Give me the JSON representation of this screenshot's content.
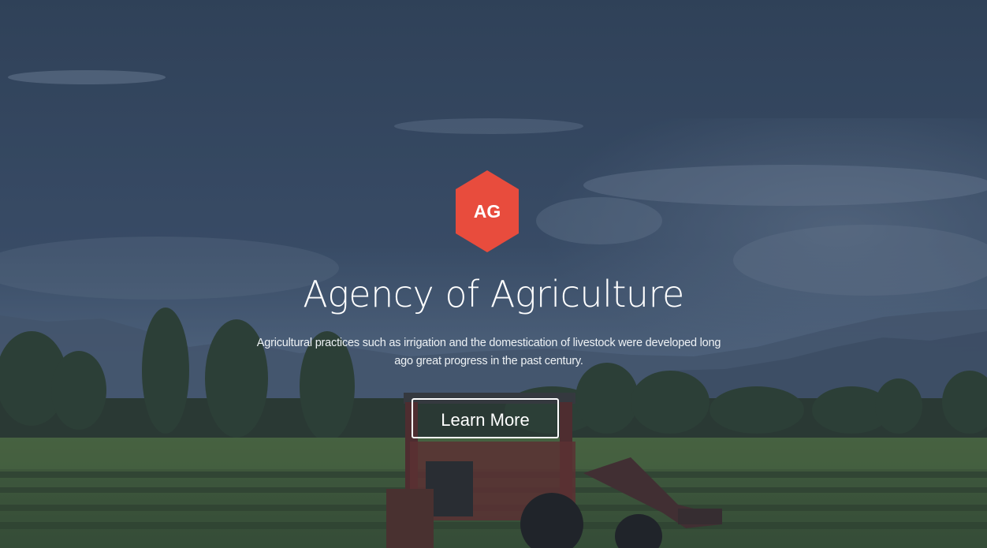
{
  "hero": {
    "logo_text": "AG",
    "title": "Agency of Agriculture",
    "subtitle": "Agricultural practices such as irrigation and the domestication of livestock were developed long ago great progress in the past century.",
    "cta_label": "Learn More"
  },
  "colors": {
    "logo_hexagon": "#e84c3d",
    "text": "#ffffff",
    "sky_overlay": "#3e5168"
  }
}
